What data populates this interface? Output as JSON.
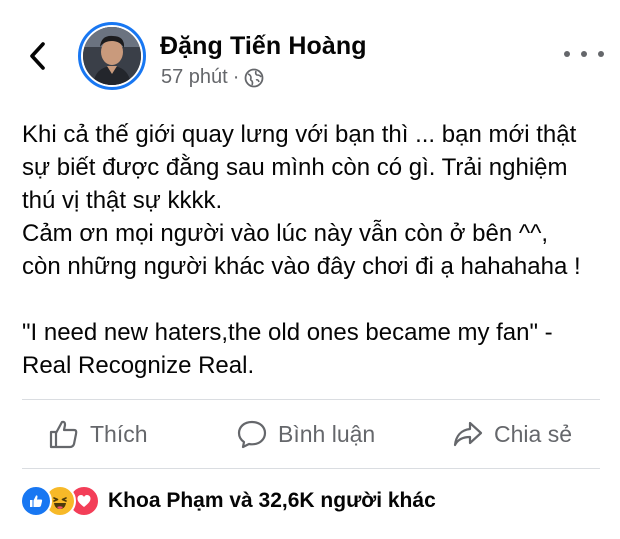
{
  "post": {
    "author_name": "Đặng Tiến Hoàng",
    "timestamp": "57 phút",
    "separator": "·",
    "audience_icon": "globe-icon",
    "body_lines": [
      "Khi cả thế giới quay lưng với bạn thì ... bạn mới thật",
      "sự biết được đằng sau mình còn có gì. Trải nghiệm",
      "thú vị thật sự kkkk.",
      "Cảm ơn mọi người vào lúc này vẫn còn ở bên ^^,",
      "còn những người khác vào đây chơi đi ạ hahahaha !",
      "",
      "\"I need new haters,the old ones became my fan\" -",
      "Real Recognize Real."
    ]
  },
  "actions": {
    "like_label": "Thích",
    "comment_label": "Bình luận",
    "share_label": "Chia sẻ"
  },
  "reactions": {
    "summary": "Khoa Phạm và 32,6K người khác",
    "types": [
      "like",
      "haha",
      "love"
    ]
  },
  "colors": {
    "accent": "#1877f2",
    "secondary_text": "#65676b",
    "divider": "#dadde1",
    "love": "#f33e58",
    "haha": "#f7b928"
  }
}
